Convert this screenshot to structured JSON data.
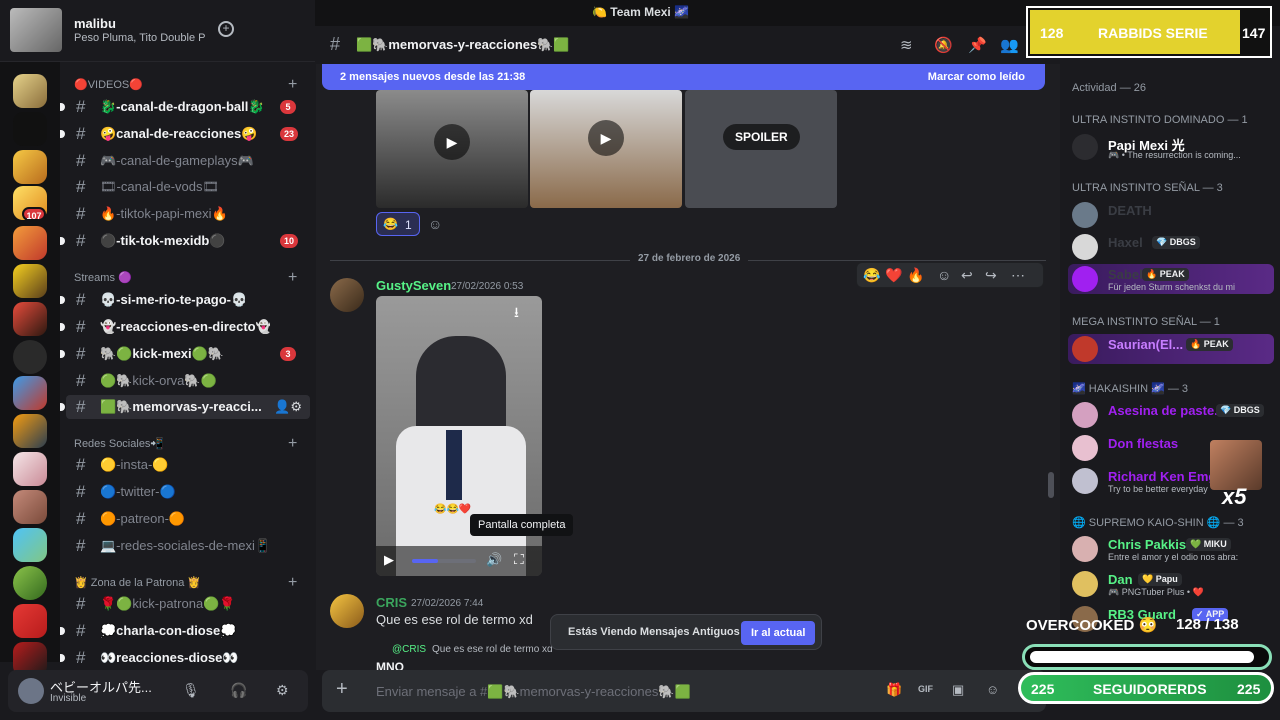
{
  "window": {
    "title": "🍋 Team Mexi 🌌"
  },
  "guild": {
    "name": "malibu",
    "now_playing": "Peso Pluma, Tito Double P"
  },
  "server_badges": {
    "s2": "107"
  },
  "categories": {
    "videos": "🔴VIDEOS🔴",
    "streams": "Streams 🟣",
    "redes": "Redes Sociales📲",
    "patrona": "👸 Zona de la Patrona 👸"
  },
  "channels": [
    {
      "label": "🐉-canal-de-dragon-ball🐉",
      "badge": "5"
    },
    {
      "label": "🤪canal-de-reacciones🤪",
      "badge": "23"
    },
    {
      "label": "🎮-canal-de-gameplays🎮",
      "badge": ""
    },
    {
      "label": "🎞-canal-de-vods🎞",
      "badge": ""
    },
    {
      "label": "🔥-tiktok-papi-mexi🔥",
      "badge": ""
    },
    {
      "label": "⚫-tik-tok-mexidb⚫",
      "badge": "10"
    },
    {
      "label": "💀-si-me-rio-te-pago-💀",
      "badge": ""
    },
    {
      "label": "👻-reacciones-en-directo👻",
      "badge": ""
    },
    {
      "label": "🐘🟢kick-mexi🟢🐘",
      "badge": "3"
    },
    {
      "label": "🟢🐘kick-orva🐘🟢",
      "badge": ""
    },
    {
      "label": "🟩🐘memorvas-y-reacci...",
      "badge": ""
    },
    {
      "label": "🟡-insta-🟡",
      "badge": ""
    },
    {
      "label": "🔵-twitter-🔵",
      "badge": ""
    },
    {
      "label": "🟠-patreon-🟠",
      "badge": ""
    },
    {
      "label": "💻-redes-sociales-de-mexi📱",
      "badge": ""
    },
    {
      "label": "🌹🟢kick-patrona🟢🌹",
      "badge": ""
    },
    {
      "label": "💭charla-con-diose💭",
      "badge": ""
    },
    {
      "label": "👀reacciones-diose👀",
      "badge": ""
    }
  ],
  "user": {
    "name": "ベビーオルパ先...",
    "status": "Invisible"
  },
  "chat": {
    "channel_name": "🟩🐘memorvas-y-reacciones🐘🟩",
    "new_messages": "2 mensajes nuevos desde las 21:38",
    "mark_read": "Marcar como leído",
    "spoiler": "SPOILER",
    "reaction": {
      "emoji": "😂",
      "count": "1"
    },
    "date_divider": "27 de febrero de 2026",
    "messages": [
      {
        "author": "GustySeven",
        "time": "27/02/2026 0:53"
      },
      {
        "author": "CRIS",
        "time": "27/02/2026 7:44",
        "text": "Que es ese rol de termo xd"
      }
    ],
    "reply": {
      "author": "@CRIS",
      "text": "Que es ese rol de termo xd"
    },
    "next_author": "MNO",
    "video_emojis": "😂😂❤️",
    "tooltip": "Pantalla completa",
    "old_messages": "Estás Viendo Mensajes Antiguos",
    "jump_present": "Ir al actual",
    "composer_placeholder": "Enviar mensaje a #🟩🐘memorvas-y-reacciones🐘🟩"
  },
  "members": {
    "activity": "Actividad — 26",
    "sections": [
      "ULTRA INSTINTO DOMINADO — 1",
      "ULTRA INSTINTO SEÑAL — 3",
      "MEGA INSTINTO SEÑAL — 1",
      "🌌 HAKAISHIN 🌌 — 3",
      "🌐 SUPREMO KAIO-SHIN 🌐 — 3"
    ],
    "rows": [
      {
        "name": "Papi Mexi 光",
        "sub": "🎮 • The resurrection is coming...",
        "tag": "",
        "color": "#ffffff"
      },
      {
        "name": "DEATH",
        "sub": "",
        "tag": "",
        "color": "#3a3d44"
      },
      {
        "name": "Haxel",
        "sub": "",
        "tag": "💎 DBGS",
        "color": "#3a3d44"
      },
      {
        "name": "Sabel",
        "sub": "Für jeden Sturm schenkst du mi",
        "tag": "🔥 PEAK",
        "color": "#3a3d44"
      },
      {
        "name": "Saurian(El...",
        "sub": "",
        "tag": "🔥 PEAK",
        "color": "#c77dff"
      },
      {
        "name": "Asesina de paste...",
        "sub": "",
        "tag": "💎 DBGS",
        "color": "#a020f0"
      },
      {
        "name": "Don flestas",
        "sub": "",
        "tag": "",
        "color": "#a020f0"
      },
      {
        "name": "Richard Ken Emg...",
        "sub": "Try to be better everyday",
        "tag": "",
        "color": "#a020f0"
      },
      {
        "name": "Chris Pakkis",
        "sub": "Entre el amor y el odio nos abra:",
        "tag": "💚 MIKU",
        "color": "#57f287"
      },
      {
        "name": "Dan",
        "sub": "🎮 PNGTuber Plus • ❤️",
        "tag": "💛 Papu",
        "color": "#57f287"
      },
      {
        "name": "RB3 Guard",
        "sub": "",
        "tag": "✓ APP",
        "color": "#57f287"
      }
    ]
  },
  "overlay": {
    "top_left": "128",
    "top_label": "RABBIDS SERIE",
    "top_right": "147",
    "overcooked": "OVERCOOKED 😳",
    "overcooked_count": "128",
    "overcooked_total": "/ 138",
    "followers_left": "225",
    "followers_label": "SEGUIDORERDS",
    "followers_right": "225",
    "multiplier": "x5"
  }
}
